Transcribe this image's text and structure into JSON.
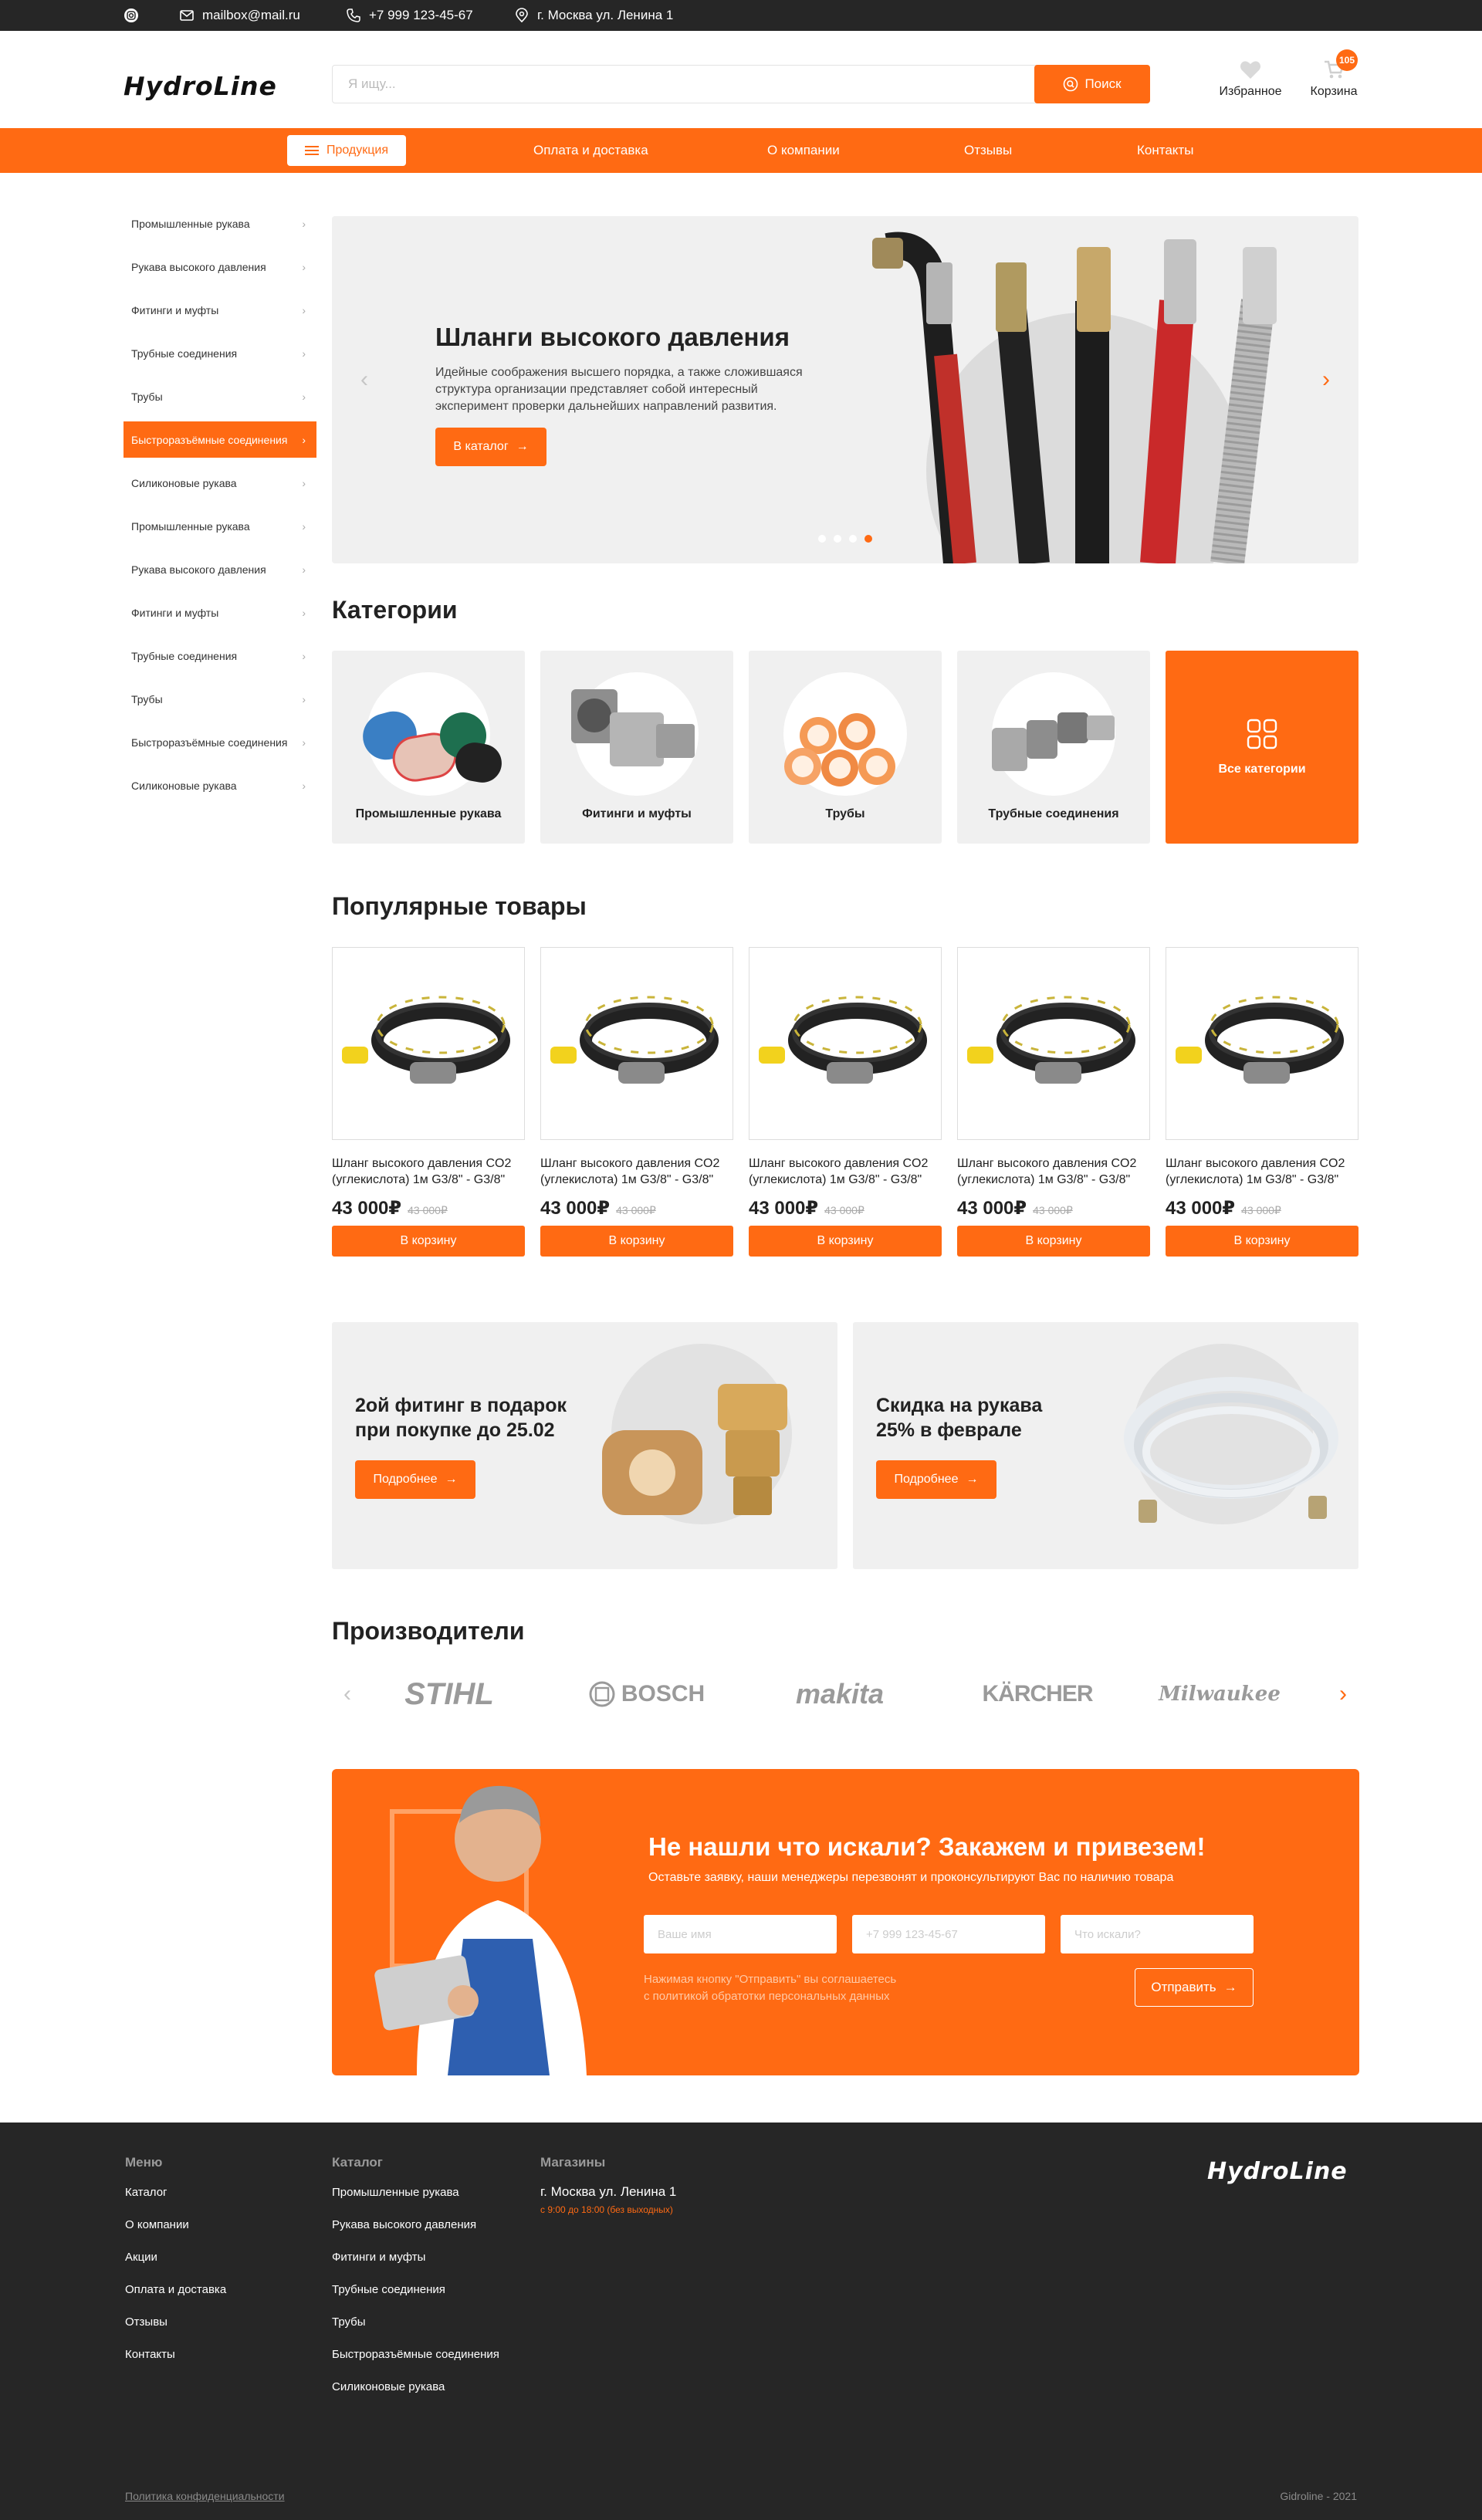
{
  "topbar": {
    "email": "mailbox@mail.ru",
    "phone": "+7 999 123-45-67",
    "address": "г. Москва ул. Ленина 1"
  },
  "header": {
    "logo": "HydroLine",
    "search_placeholder": "Я ищу...",
    "search_button": "Поиск",
    "favorites": "Избранное",
    "cart": "Корзина",
    "cart_count": "105"
  },
  "nav": {
    "products": "Продукция",
    "links": [
      "Оплата и доставка",
      "О компании",
      "Отзывы",
      "Контакты"
    ]
  },
  "sidebar": {
    "items": [
      "Промышленные рукава",
      "Рукава высокого давления",
      "Фитинги и муфты",
      "Трубные соединения",
      "Трубы",
      "Быстроразъёмные соединения",
      "Силиконовые рукава",
      "Промышленные рукава",
      "Рукава высокого давления",
      "Фитинги и муфты",
      "Трубные соединения",
      "Трубы",
      "Быстроразъёмные соединения",
      "Силиконовые рукава"
    ],
    "active_index": 5
  },
  "hero": {
    "title": "Шланги высокого давления",
    "text": "Идейные соображения высшего порядка, а также сложившаяся структура организации представляет собой интересный эксперимент проверки дальнейших направлений развития.",
    "button": "В каталог",
    "slides_total": 4,
    "active_slide": 4
  },
  "categories": {
    "title": "Категории",
    "items": [
      "Промышленные рукава",
      "Фитинги и муфты",
      "Трубы",
      "Трубные соединения"
    ],
    "all": "Все категории"
  },
  "popular": {
    "title": "Популярные товары",
    "products": [
      {
        "name": "Шланг высокого давления CO2 (углекислота) 1м G3/8\" - G3/8\"",
        "price": "43 000₽",
        "old_price": "43 000₽",
        "button": "В корзину"
      },
      {
        "name": "Шланг высокого давления CO2 (углекислота) 1м G3/8\" - G3/8\"",
        "price": "43 000₽",
        "old_price": "43 000₽",
        "button": "В корзину"
      },
      {
        "name": "Шланг высокого давления CO2 (углекислота) 1м G3/8\" - G3/8\"",
        "price": "43 000₽",
        "old_price": "43 000₽",
        "button": "В корзину"
      },
      {
        "name": "Шланг высокого давления CO2 (углекислота) 1м G3/8\" - G3/8\"",
        "price": "43 000₽",
        "old_price": "43 000₽",
        "button": "В корзину"
      },
      {
        "name": "Шланг высокого давления CO2 (углекислота) 1м G3/8\" - G3/8\"",
        "price": "43 000₽",
        "old_price": "43 000₽",
        "button": "В корзину"
      }
    ]
  },
  "promos": [
    {
      "title_line1": "2ой фитинг в подарок",
      "title_line2": "при покупке до 25.02",
      "button": "Подробнее"
    },
    {
      "title_line1": "Скидка на рукава",
      "title_line2": "25% в феврале",
      "button": "Подробнее"
    }
  ],
  "brands": {
    "title": "Производители",
    "items": [
      "STIHL",
      "BOSCH",
      "makita",
      "KÄRCHER",
      "Milwaukee"
    ]
  },
  "request": {
    "title": "Не нашли что искали? Закажем и привезем!",
    "subtitle": "Оставьте заявку, наши менеджеры перезвонят и проконсультируют Вас по наличию товара",
    "name_placeholder": "Ваше имя",
    "phone_placeholder": "+7 999 123-45-67",
    "query_placeholder": "Что искали?",
    "policy_line1": "Нажимая кнопку \"Отправить\" вы соглашаетесь",
    "policy_line2": "с политикой обратотки персональных данных",
    "button": "Отправить"
  },
  "footer": {
    "menu_title": "Меню",
    "menu": [
      "Каталог",
      "О компании",
      "Акции",
      "Оплата и доставка",
      "Отзывы",
      "Контакты"
    ],
    "catalog_title": "Каталог",
    "catalog": [
      "Промышленные рукава",
      "Рукава высокого давления",
      "Фитинги и муфты",
      "Трубные соединения",
      "Трубы",
      "Быстроразъёмные соединения",
      "Силиконовые рукава"
    ],
    "stores_title": "Магазины",
    "store_address": "г. Москва ул. Ленина 1",
    "store_hours": "с 9:00 до 18:00 (без выходных)",
    "logo": "HydroLine",
    "privacy": "Политика конфиденциальности",
    "copyright": "Gidroline - 2021"
  },
  "colors": {
    "accent": "#ff6a13",
    "dark": "#262626",
    "card_bg": "#f0f0f0"
  }
}
